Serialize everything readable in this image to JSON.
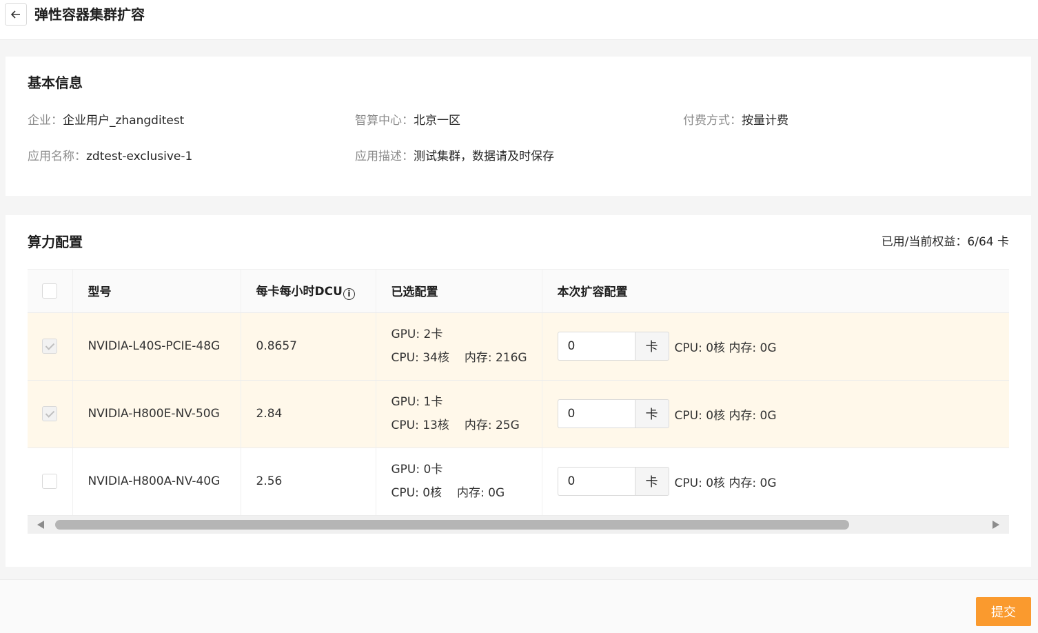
{
  "header": {
    "title": "弹性容器集群扩容",
    "back_icon": "arrow-left-icon"
  },
  "basic_info": {
    "title": "基本信息",
    "fields": [
      {
        "label": "企业：",
        "value": "企业用户_zhangditest"
      },
      {
        "label": "智算中心：",
        "value": "北京一区"
      },
      {
        "label": "付费方式：",
        "value": "按量计费"
      },
      {
        "label": "应用名称：",
        "value": "zdtest-exclusive-1"
      },
      {
        "label": "应用描述：",
        "value": "测试集群，数据请及时保存"
      }
    ]
  },
  "compute": {
    "title": "算力配置",
    "quota": "已用/当前权益：6/64 卡",
    "columns": {
      "model": "型号",
      "dcu": "每卡每小时DCU",
      "selected": "已选配置",
      "expand": "本次扩容配置"
    },
    "info_icon": "ⓘ",
    "rows": [
      {
        "checked": true,
        "model": "NVIDIA-L40S-PCIE-48G",
        "dcu": "0.8657",
        "gpu": "GPU: 2卡",
        "cpu": "CPU: 34核",
        "mem": "内存: 216G",
        "input_value": "0",
        "unit": "卡",
        "summary": "CPU: 0核 内存: 0G"
      },
      {
        "checked": true,
        "model": "NVIDIA-H800E-NV-50G",
        "dcu": "2.84",
        "gpu": "GPU: 1卡",
        "cpu": "CPU: 13核",
        "mem": "内存: 25G",
        "input_value": "0",
        "unit": "卡",
        "summary": "CPU: 0核 内存: 0G"
      },
      {
        "checked": false,
        "model": "NVIDIA-H800A-NV-40G",
        "dcu": "2.56",
        "gpu": "GPU: 0卡",
        "cpu": "CPU: 0核",
        "mem": "内存: 0G",
        "input_value": "0",
        "unit": "卡",
        "summary": "CPU: 0核 内存: 0G"
      }
    ]
  },
  "footer": {
    "submit_label": "提交"
  },
  "colors": {
    "accent": "#fa9a2e",
    "selected_row": "#fff8ea"
  }
}
